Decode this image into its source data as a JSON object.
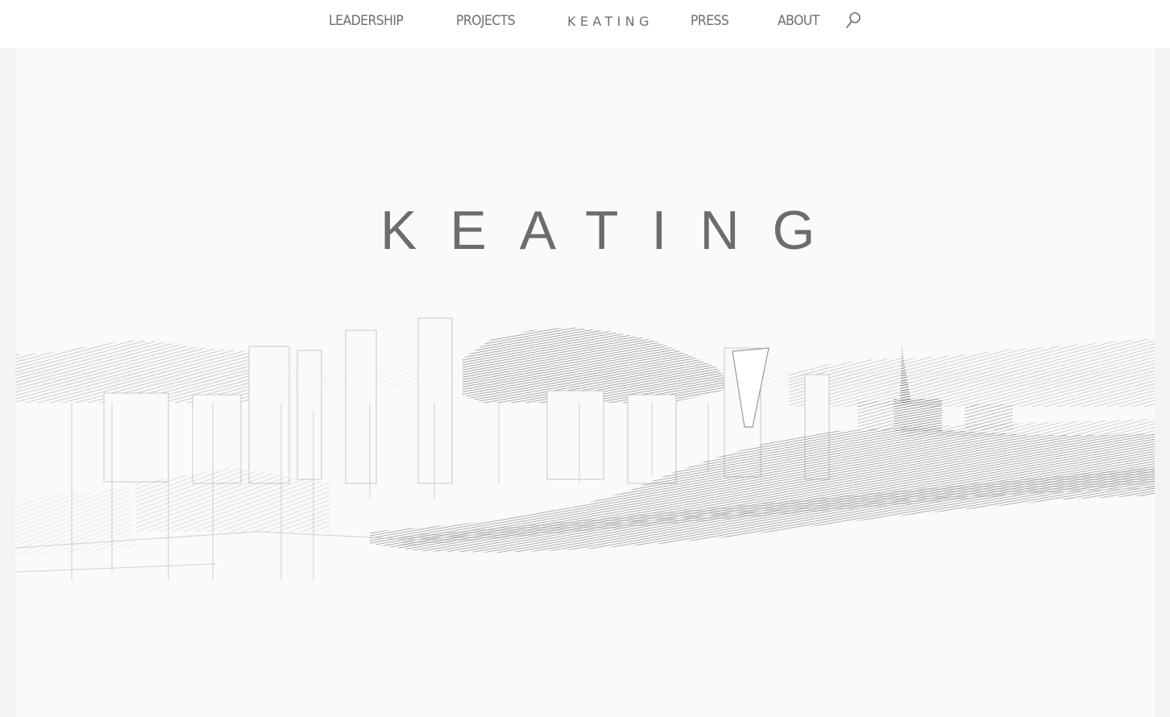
{
  "nav": {
    "items": [
      {
        "label": "LEADERSHIP"
      },
      {
        "label": "PROJECTS"
      },
      {
        "label": "KEATING"
      },
      {
        "label": "PRESS"
      },
      {
        "label": "ABOUT"
      }
    ],
    "search_icon": "search-icon"
  },
  "hero": {
    "title": "KEATING",
    "image": "pencil-sketch-city-skyline"
  },
  "colors": {
    "nav_text": "#6e6e6e",
    "title": "#6c6c6c",
    "background": "#fafafa",
    "topbar": "#ffffff"
  }
}
